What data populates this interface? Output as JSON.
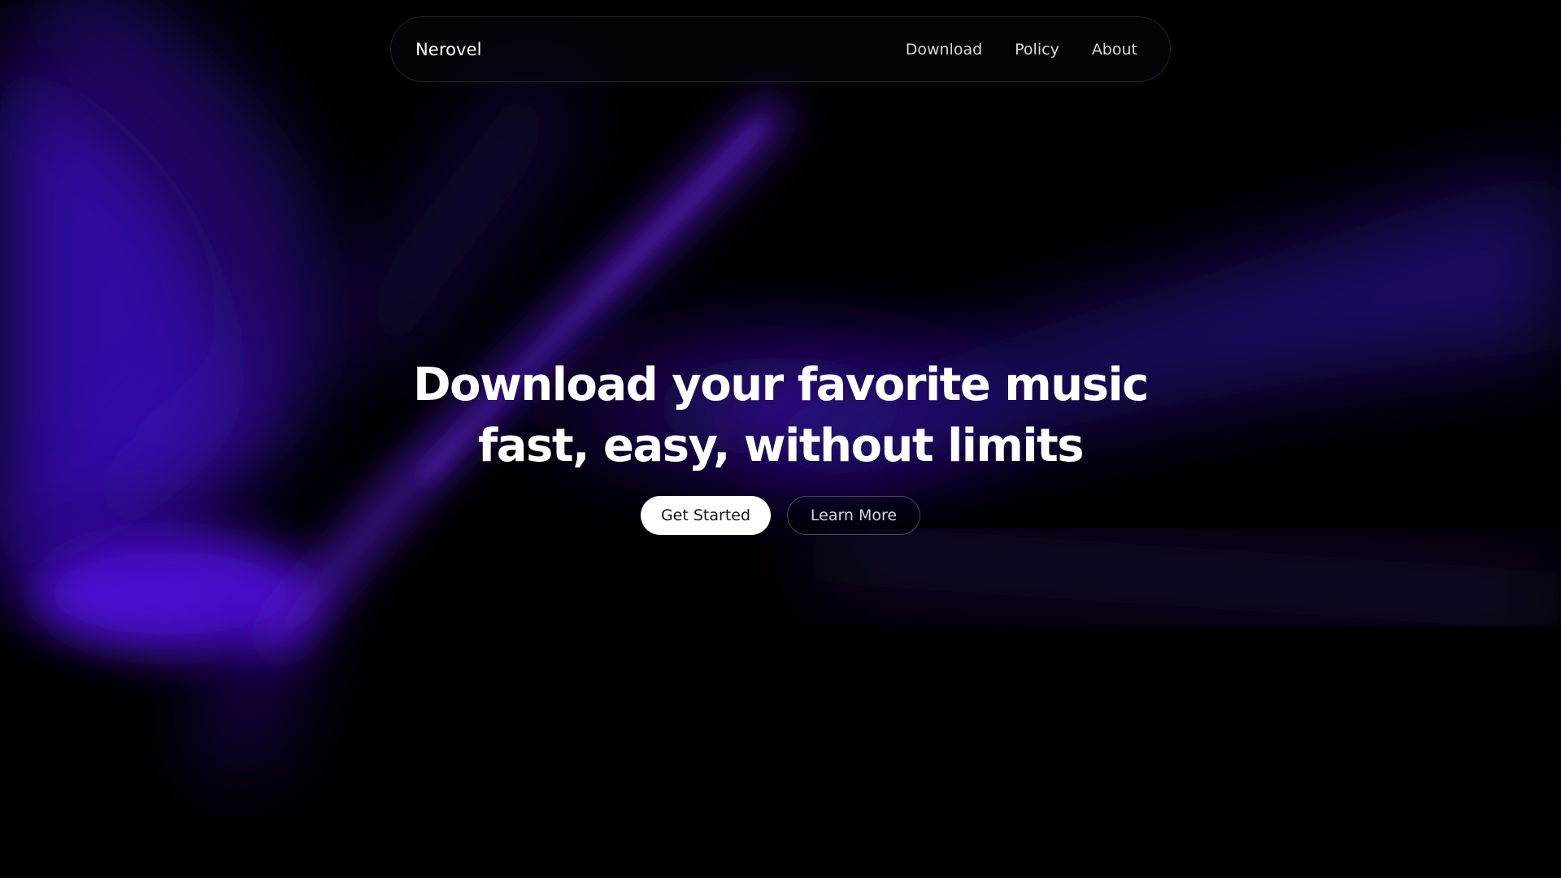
{
  "brand": {
    "name": "Nerovel"
  },
  "nav": {
    "links": [
      {
        "label": "Download"
      },
      {
        "label": "Policy"
      },
      {
        "label": "About"
      }
    ]
  },
  "hero": {
    "title_line1": "Download your favorite music",
    "title_line2": "fast, easy, without limits"
  },
  "actions": {
    "primary_label": "Get Started",
    "secondary_label": "Learn More"
  },
  "colors": {
    "background": "#000000",
    "accent": "#5b14e6",
    "primary_button": "#ffffff"
  }
}
